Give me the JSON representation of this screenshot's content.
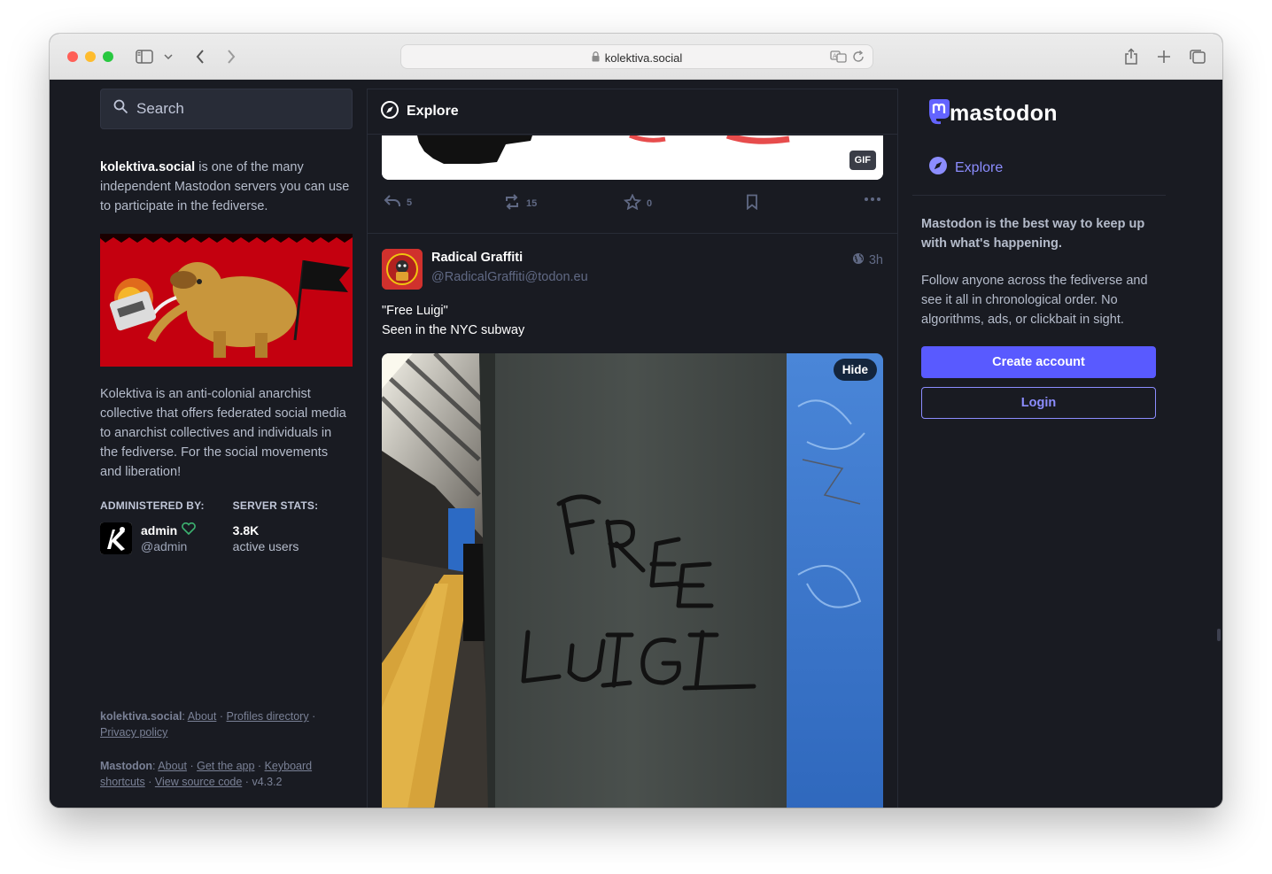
{
  "browser": {
    "url": "kolektiva.social",
    "traffic_colors": {
      "close": "#ff5f57",
      "minimize": "#febc2e",
      "maximize": "#28c840"
    }
  },
  "search": {
    "placeholder": "Search"
  },
  "server": {
    "name": "kolektiva.social",
    "intro": " is one of the many independent Mastodon servers you can use to participate in the fediverse.",
    "description": "Kolektiva is an anti-colonial anarchist collective that offers federated social media to anarchist collectives and individuals in the fediverse. For the social movements and liberation!",
    "administered_by_label": "ADMINISTERED BY:",
    "server_stats_label": "SERVER STATS:",
    "admin_name": "admin",
    "admin_handle": "@admin",
    "active_users_count": "3.8K",
    "active_users_label": "active users"
  },
  "footer": {
    "server_label": "kolektiva.social",
    "server_links": [
      "About",
      "Profiles directory",
      "Privacy policy"
    ],
    "mastodon_label": "Mastodon",
    "mastodon_links": [
      "About",
      "Get the app",
      "Keyboard shortcuts",
      "View source code"
    ],
    "version": "v4.3.2"
  },
  "column": {
    "title": "Explore"
  },
  "previous_post": {
    "media_badge": "GIF",
    "replies": "5",
    "boosts": "15",
    "favourites": "0"
  },
  "post": {
    "display_name": "Radical Graffiti",
    "handle": "@RadicalGraffiti@todon.eu",
    "time": "3h",
    "text_line1": "\"Free Luigi\"",
    "text_line2": "Seen in the NYC subway",
    "hide_label": "Hide"
  },
  "sidebar": {
    "brand": "mastodon",
    "nav_explore": "Explore",
    "pitch_strong": "Mastodon is the best way to keep up with what's happening.",
    "pitch": "Follow anyone across the fediverse and see it all in chronological order. No algorithms, ads, or clickbait in sight.",
    "create_account": "Create account",
    "login": "Login"
  },
  "colors": {
    "background": "#191b22",
    "panel": "#282c37",
    "accent": "#595aff",
    "accent_text": "#8c8dff",
    "muted": "#606984"
  }
}
